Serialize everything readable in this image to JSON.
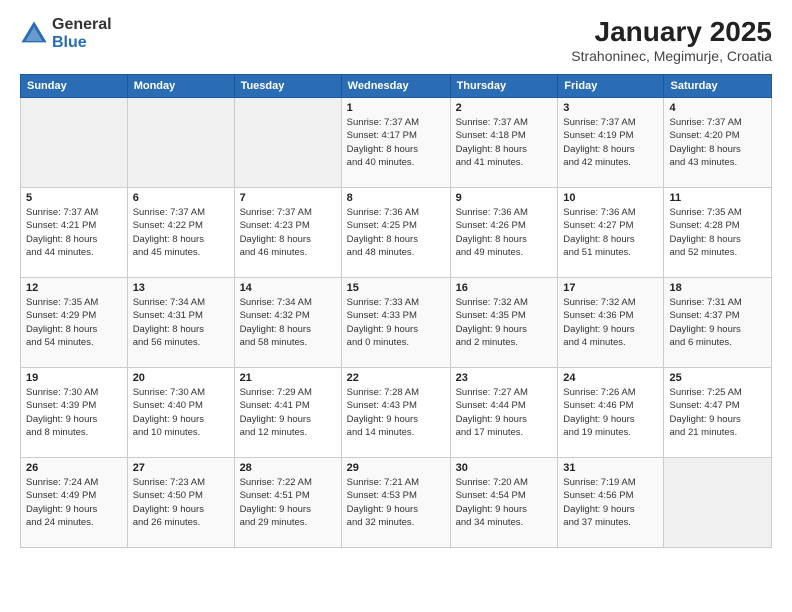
{
  "header": {
    "logo_general": "General",
    "logo_blue": "Blue",
    "title": "January 2025",
    "subtitle": "Strahoninec, Megimurje, Croatia"
  },
  "calendar": {
    "weekdays": [
      "Sunday",
      "Monday",
      "Tuesday",
      "Wednesday",
      "Thursday",
      "Friday",
      "Saturday"
    ],
    "weeks": [
      [
        {
          "day": "",
          "info": ""
        },
        {
          "day": "",
          "info": ""
        },
        {
          "day": "",
          "info": ""
        },
        {
          "day": "1",
          "info": "Sunrise: 7:37 AM\nSunset: 4:17 PM\nDaylight: 8 hours\nand 40 minutes."
        },
        {
          "day": "2",
          "info": "Sunrise: 7:37 AM\nSunset: 4:18 PM\nDaylight: 8 hours\nand 41 minutes."
        },
        {
          "day": "3",
          "info": "Sunrise: 7:37 AM\nSunset: 4:19 PM\nDaylight: 8 hours\nand 42 minutes."
        },
        {
          "day": "4",
          "info": "Sunrise: 7:37 AM\nSunset: 4:20 PM\nDaylight: 8 hours\nand 43 minutes."
        }
      ],
      [
        {
          "day": "5",
          "info": "Sunrise: 7:37 AM\nSunset: 4:21 PM\nDaylight: 8 hours\nand 44 minutes."
        },
        {
          "day": "6",
          "info": "Sunrise: 7:37 AM\nSunset: 4:22 PM\nDaylight: 8 hours\nand 45 minutes."
        },
        {
          "day": "7",
          "info": "Sunrise: 7:37 AM\nSunset: 4:23 PM\nDaylight: 8 hours\nand 46 minutes."
        },
        {
          "day": "8",
          "info": "Sunrise: 7:36 AM\nSunset: 4:25 PM\nDaylight: 8 hours\nand 48 minutes."
        },
        {
          "day": "9",
          "info": "Sunrise: 7:36 AM\nSunset: 4:26 PM\nDaylight: 8 hours\nand 49 minutes."
        },
        {
          "day": "10",
          "info": "Sunrise: 7:36 AM\nSunset: 4:27 PM\nDaylight: 8 hours\nand 51 minutes."
        },
        {
          "day": "11",
          "info": "Sunrise: 7:35 AM\nSunset: 4:28 PM\nDaylight: 8 hours\nand 52 minutes."
        }
      ],
      [
        {
          "day": "12",
          "info": "Sunrise: 7:35 AM\nSunset: 4:29 PM\nDaylight: 8 hours\nand 54 minutes."
        },
        {
          "day": "13",
          "info": "Sunrise: 7:34 AM\nSunset: 4:31 PM\nDaylight: 8 hours\nand 56 minutes."
        },
        {
          "day": "14",
          "info": "Sunrise: 7:34 AM\nSunset: 4:32 PM\nDaylight: 8 hours\nand 58 minutes."
        },
        {
          "day": "15",
          "info": "Sunrise: 7:33 AM\nSunset: 4:33 PM\nDaylight: 9 hours\nand 0 minutes."
        },
        {
          "day": "16",
          "info": "Sunrise: 7:32 AM\nSunset: 4:35 PM\nDaylight: 9 hours\nand 2 minutes."
        },
        {
          "day": "17",
          "info": "Sunrise: 7:32 AM\nSunset: 4:36 PM\nDaylight: 9 hours\nand 4 minutes."
        },
        {
          "day": "18",
          "info": "Sunrise: 7:31 AM\nSunset: 4:37 PM\nDaylight: 9 hours\nand 6 minutes."
        }
      ],
      [
        {
          "day": "19",
          "info": "Sunrise: 7:30 AM\nSunset: 4:39 PM\nDaylight: 9 hours\nand 8 minutes."
        },
        {
          "day": "20",
          "info": "Sunrise: 7:30 AM\nSunset: 4:40 PM\nDaylight: 9 hours\nand 10 minutes."
        },
        {
          "day": "21",
          "info": "Sunrise: 7:29 AM\nSunset: 4:41 PM\nDaylight: 9 hours\nand 12 minutes."
        },
        {
          "day": "22",
          "info": "Sunrise: 7:28 AM\nSunset: 4:43 PM\nDaylight: 9 hours\nand 14 minutes."
        },
        {
          "day": "23",
          "info": "Sunrise: 7:27 AM\nSunset: 4:44 PM\nDaylight: 9 hours\nand 17 minutes."
        },
        {
          "day": "24",
          "info": "Sunrise: 7:26 AM\nSunset: 4:46 PM\nDaylight: 9 hours\nand 19 minutes."
        },
        {
          "day": "25",
          "info": "Sunrise: 7:25 AM\nSunset: 4:47 PM\nDaylight: 9 hours\nand 21 minutes."
        }
      ],
      [
        {
          "day": "26",
          "info": "Sunrise: 7:24 AM\nSunset: 4:49 PM\nDaylight: 9 hours\nand 24 minutes."
        },
        {
          "day": "27",
          "info": "Sunrise: 7:23 AM\nSunset: 4:50 PM\nDaylight: 9 hours\nand 26 minutes."
        },
        {
          "day": "28",
          "info": "Sunrise: 7:22 AM\nSunset: 4:51 PM\nDaylight: 9 hours\nand 29 minutes."
        },
        {
          "day": "29",
          "info": "Sunrise: 7:21 AM\nSunset: 4:53 PM\nDaylight: 9 hours\nand 32 minutes."
        },
        {
          "day": "30",
          "info": "Sunrise: 7:20 AM\nSunset: 4:54 PM\nDaylight: 9 hours\nand 34 minutes."
        },
        {
          "day": "31",
          "info": "Sunrise: 7:19 AM\nSunset: 4:56 PM\nDaylight: 9 hours\nand 37 minutes."
        },
        {
          "day": "",
          "info": ""
        }
      ]
    ]
  }
}
